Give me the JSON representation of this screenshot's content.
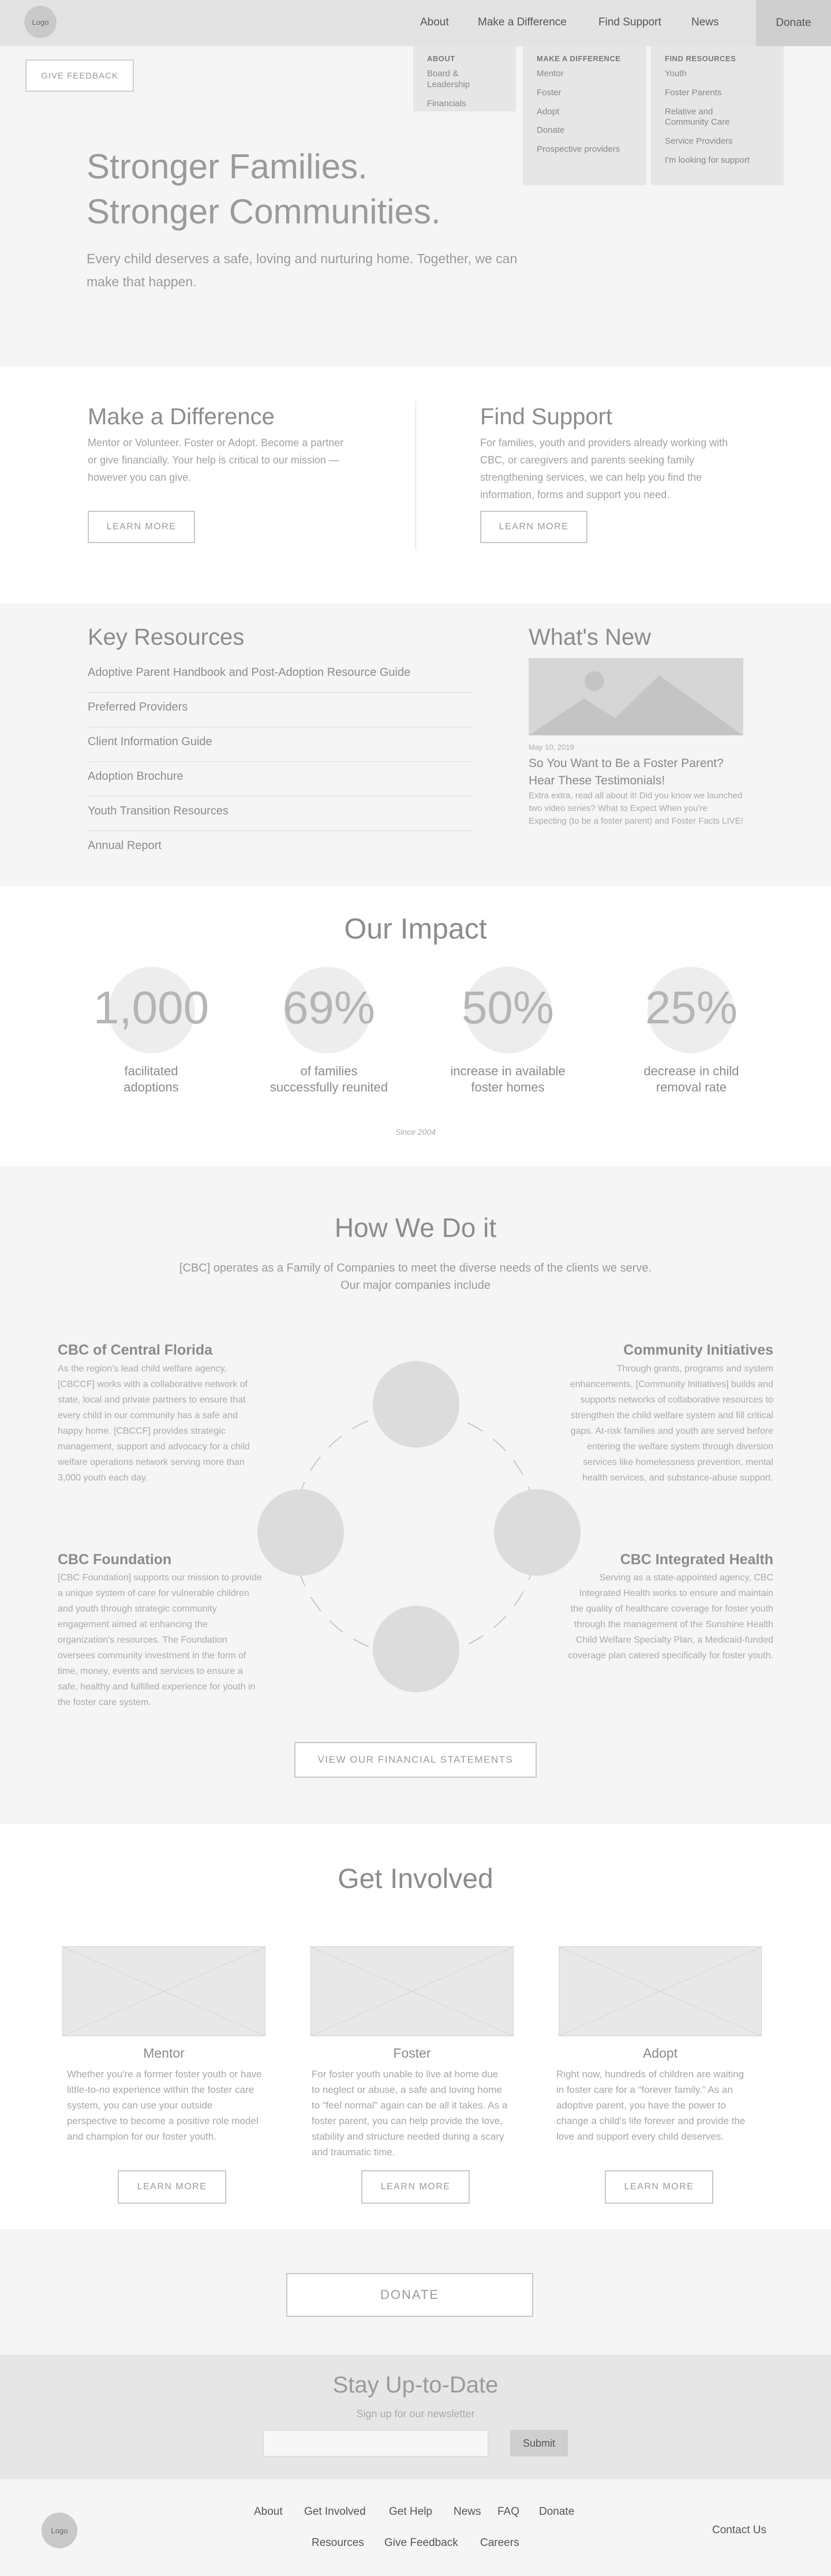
{
  "header": {
    "logo": "Logo",
    "nav": [
      "About",
      "Make a Difference",
      "Find Support",
      "News"
    ],
    "donate": "Donate"
  },
  "menu": {
    "about": {
      "heading": "ABOUT",
      "items": [
        "Board & Leadership",
        "Financials"
      ]
    },
    "difference": {
      "heading": "MAKE A DIFFERENCE",
      "items": [
        "Mentor",
        "Foster",
        "Adopt",
        "Donate",
        "Prospective providers"
      ]
    },
    "resources": {
      "heading": "FIND RESOURCES",
      "items": [
        "Youth",
        "Foster Parents",
        "Relative and Community Care",
        "Service Providers",
        "I'm looking for support"
      ]
    }
  },
  "feedback": "GIVE FEEDBACK",
  "hero": {
    "title_line1": "Stronger Families.",
    "title_line2": "Stronger Communities.",
    "subtitle": "Every child deserves  a safe, loving and nurturing home. Together, we can make that happen."
  },
  "difference": {
    "title": "Make a Difference",
    "text": "Mentor or Volunteer. Foster or Adopt. Become a partner or give financially. Your help is critical to our mission — however you can give.",
    "button": "LEARN MORE"
  },
  "support": {
    "title": "Find Support",
    "text": "For families, youth and providers already working with CBC, or caregivers and parents seeking family strengthening services, we can help you find the information, forms and support you need.",
    "button": "LEARN MORE"
  },
  "resources": {
    "title": "Key Resources",
    "items": [
      "Adoptive Parent Handbook and Post-Adoption Resource Guide",
      "Preferred Providers",
      "Client Information Guide",
      "Adoption Brochure",
      "Youth Transition Resources",
      "Annual Report"
    ]
  },
  "news": {
    "title": "What's New",
    "date": "May 10, 2019",
    "headline": "So You Want to Be a Foster Parent? Hear These Testimonials!",
    "excerpt": "Extra extra, read all about it! Did you know we launched two video series? What to Expect When you're Expecting (to be a foster parent) and Foster Facts LIVE!"
  },
  "impact": {
    "title": "Our Impact",
    "stats": [
      {
        "value": "1,000",
        "label_line1": "facilitated",
        "label_line2": "adoptions"
      },
      {
        "value": "69%",
        "label_line1": "of families",
        "label_line2": "successfully reunited"
      },
      {
        "value": "50%",
        "label_line1": "increase in available",
        "label_line2": "foster homes"
      },
      {
        "value": "25%",
        "label_line1": "decrease in child",
        "label_line2": "removal rate"
      }
    ],
    "since": "Since 2004"
  },
  "how": {
    "title": "How We Do it",
    "subtitle_line1": "[CBC] operates as a Family of Companies to meet the diverse needs of the clients we serve.",
    "subtitle_line2": "Our major companies include",
    "companies": [
      {
        "name": "CBC of Central Florida",
        "text": "As the region's lead child welfare agency, [CBCCF] works with a collaborative network of state, local and private partners to ensure that every child in our community has a safe and happy home. [CBCCF] provides strategic management, support and advocacy for a child welfare operations network serving more than 3,000 youth each day."
      },
      {
        "name": "Community Initiatives",
        "text": "Through grants, programs and system enhancements, [Community Initiatives] builds and supports networks of collaborative resources to strengthen the child welfare system and fill critical gaps. At-risk families and youth are served before entering the welfare system through diversion services like homelessness prevention, mental health services, and substance-abuse support."
      },
      {
        "name": "CBC Foundation",
        "text": "[CBC Foundation] supports our mission to provide a unique system of care for vulnerable children and youth through strategic community engagement aimed at enhancing the organization's resources. The Foundation oversees community investment in the form of time, money, events and services to ensure a safe, healthy and fulfilled experience for youth in the foster care system."
      },
      {
        "name": "CBC Integrated Health",
        "text": "Serving as a state-appointed agency, CBC Integrated Health works to ensure and maintain the quality of healthcare coverage for foster youth through the management of the Sunshine Health Child Welfare Specialty Plan, a Medicaid-funded coverage plan catered specifically for foster youth."
      }
    ],
    "button": "VIEW OUR FINANCIAL STATEMENTS"
  },
  "involved": {
    "title": "Get Involved",
    "cards": [
      {
        "title": "Mentor",
        "text": "Whether you're a former foster youth or have little-to-no experience within the foster care system, you can use your outside perspective to become a positive role model and champion for our foster youth.",
        "button": "LEARN MORE"
      },
      {
        "title": "Foster",
        "text": "For foster youth unable to live at home due to neglect or abuse, a safe and loving home to “feel normal” again can be all it takes. As a foster parent, you can help provide the love, stability and structure needed during a scary and traumatic time.",
        "button": "LEARN MORE"
      },
      {
        "title": "Adopt",
        "text": "Right now, hundreds of children are waiting in foster care for a “forever family.” As an adoptive parent, you have the power to change a child's life forever and provide the love and support every child deserves.",
        "button": "LEARN MORE"
      }
    ],
    "donate": "DONATE"
  },
  "newsletter": {
    "title": "Stay Up-to-Date",
    "subtitle": "Sign up for our newsletter",
    "placeholder": "",
    "submit": "Submit"
  },
  "footer": {
    "logo": "Logo",
    "row1": [
      "About",
      "Get Involved",
      "Get Help",
      "News",
      "FAQ",
      "Donate"
    ],
    "row2": [
      "Resources",
      "Give Feedback",
      "Careers"
    ],
    "contact": "Contact Us"
  }
}
